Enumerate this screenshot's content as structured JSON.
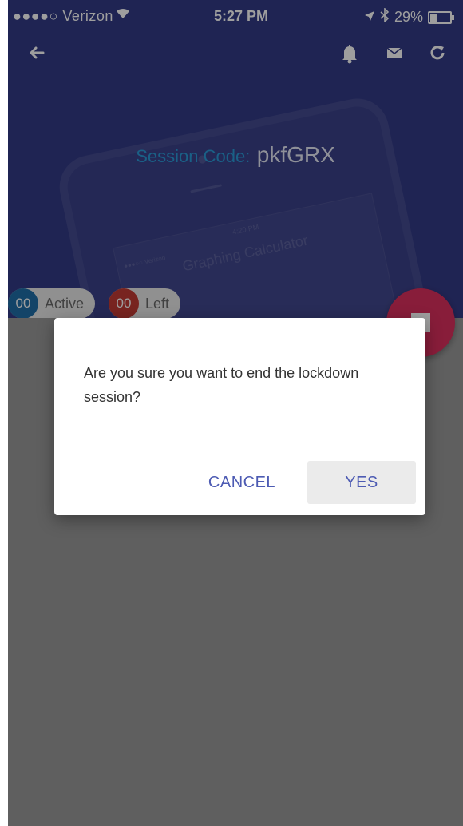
{
  "status_bar": {
    "carrier": "●●●●○ Verizon",
    "time": "5:27 PM",
    "battery": "29%",
    "battery_level": 0.29
  },
  "toolbar": {
    "back_icon": "back-arrow-icon",
    "icons": [
      "bell-icon",
      "mail-icon",
      "refresh-icon"
    ]
  },
  "session": {
    "label": "Session Code:",
    "code": "pkfGRX"
  },
  "counters": {
    "active": {
      "count": "00",
      "label": "Active",
      "color": "#1f6fa8"
    },
    "left": {
      "count": "00",
      "label": "Left",
      "color": "#c23a35"
    }
  },
  "fab": {
    "icon": "stop-icon",
    "color": "#dc2f5e"
  },
  "dialog": {
    "message": "Are you sure you want to end the lockdown session?",
    "cancel_label": "CANCEL",
    "yes_label": "YES"
  },
  "colors": {
    "header": "#333a86",
    "accent_text": "#2a9bd8",
    "button_text": "#4d5bb3"
  }
}
